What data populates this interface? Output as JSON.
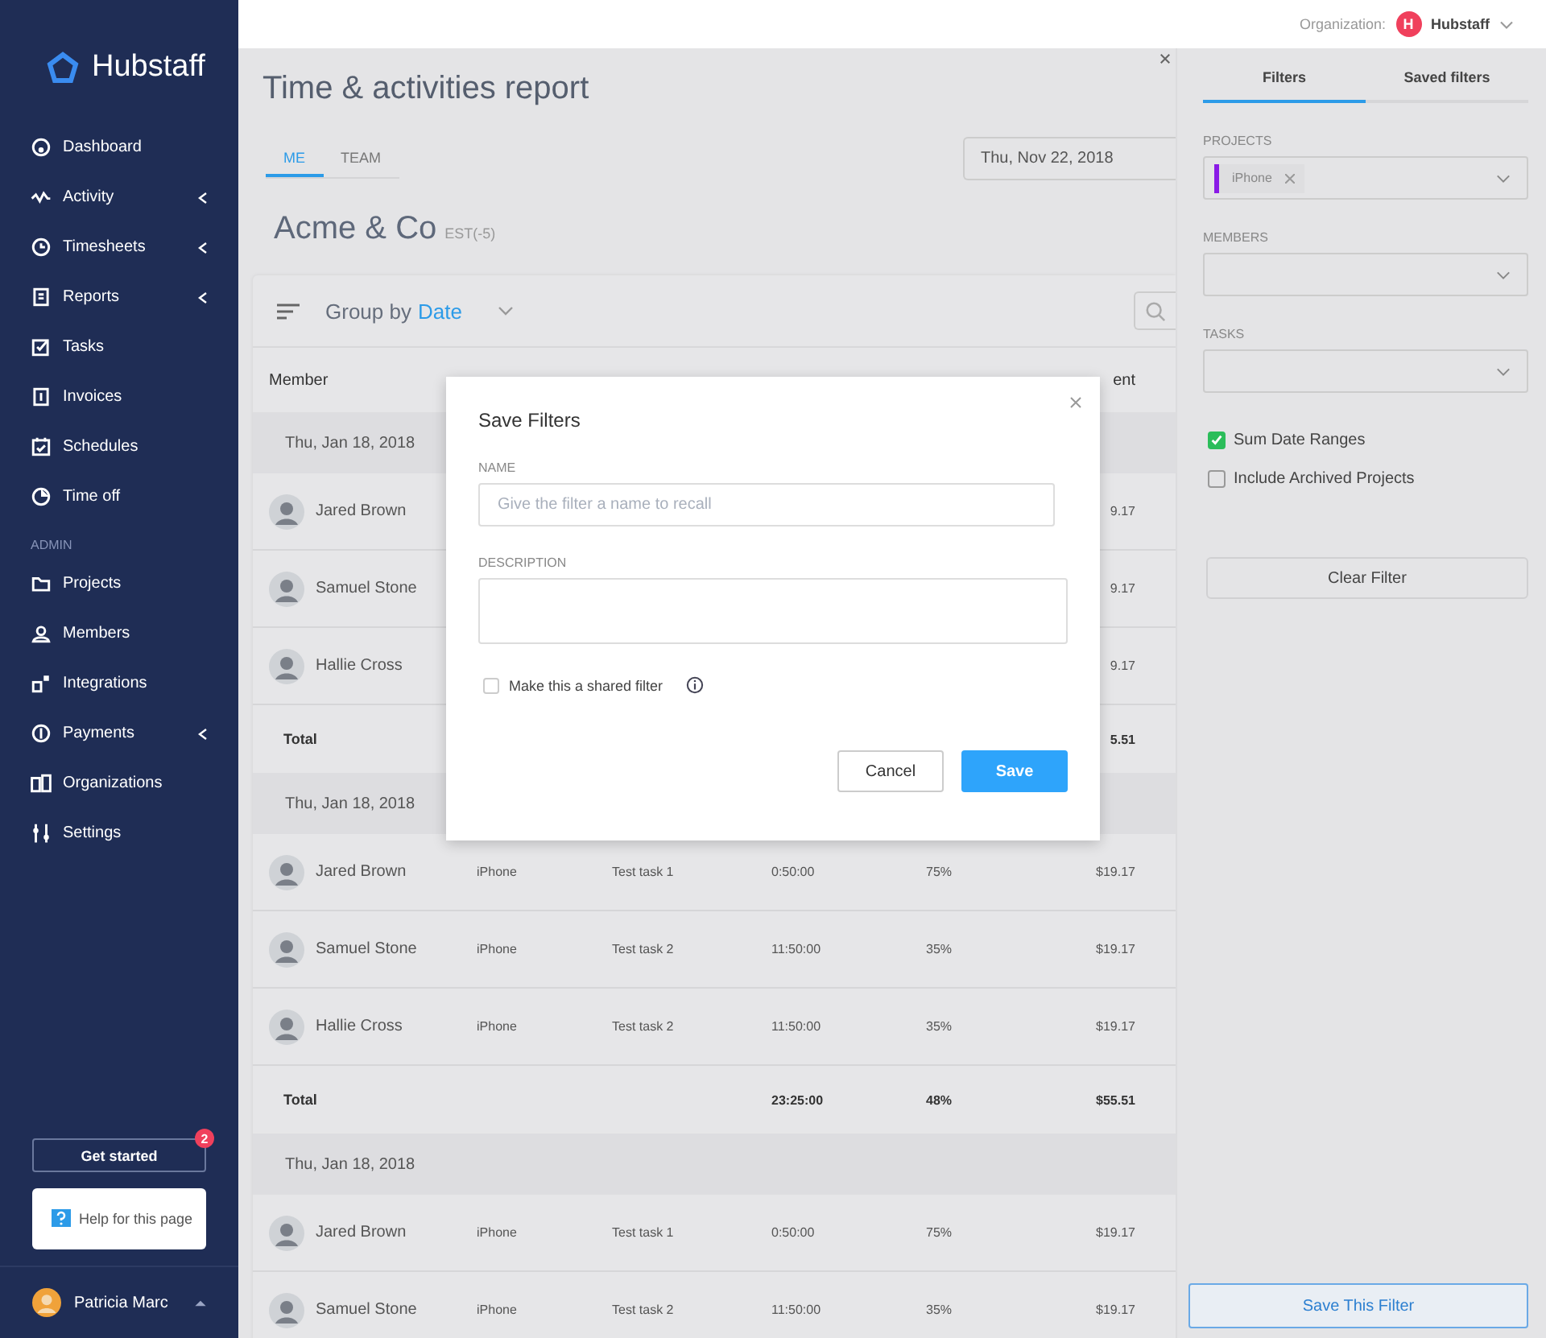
{
  "sidebar": {
    "brand": "Hubstaff",
    "sections": [
      {
        "items": [
          {
            "label": "Dashboard",
            "expandable": false
          },
          {
            "label": "Activity",
            "expandable": true
          },
          {
            "label": "Timesheets",
            "expandable": true
          },
          {
            "label": "Reports",
            "expandable": true
          },
          {
            "label": "Tasks",
            "expandable": false
          },
          {
            "label": "Invoices",
            "expandable": false
          },
          {
            "label": "Schedules",
            "expandable": false
          },
          {
            "label": "Time off",
            "expandable": false
          }
        ]
      },
      {
        "heading": "ADMIN",
        "items": [
          {
            "label": "Projects",
            "expandable": false
          },
          {
            "label": "Members",
            "expandable": false
          },
          {
            "label": "Integrations",
            "expandable": false
          },
          {
            "label": "Payments",
            "expandable": true
          },
          {
            "label": "Organizations",
            "expandable": false
          },
          {
            "label": "Settings",
            "expandable": false
          }
        ]
      }
    ],
    "get_started": {
      "label": "Get started",
      "badge": "2"
    },
    "help": "Help for this page",
    "user": "Patricia Marc"
  },
  "topbar": {
    "org_label": "Organization:",
    "org_initial": "H",
    "org_name": "Hubstaff"
  },
  "report": {
    "title": "Time & activities report",
    "tabs": [
      {
        "label": "ME",
        "selected": true
      },
      {
        "label": "TEAM",
        "selected": false
      }
    ],
    "date": "Thu, Nov 22, 2018",
    "org": "Acme & Co",
    "timezone": "EST(-5)",
    "group_by_label": "Group by",
    "group_by_value": "Date",
    "columns": {
      "member": "Member",
      "spent": "ent"
    },
    "groups": [
      {
        "date": "Thu, Jan 18, 2018",
        "rows": [
          {
            "member": "Jared Brown",
            "spent": "9.17"
          },
          {
            "member": "Samuel Stone",
            "spent": "9.17"
          },
          {
            "member": "Hallie Cross",
            "spent": "9.17"
          }
        ],
        "total": {
          "label": "Total",
          "spent": "5.51"
        }
      },
      {
        "date": "Thu, Jan 18, 2018",
        "rows": [
          {
            "member": "Jared Brown",
            "project": "iPhone",
            "task": "Test task 1",
            "time": "0:50:00",
            "activity": "75%",
            "spent": "$19.17"
          },
          {
            "member": "Samuel Stone",
            "project": "iPhone",
            "task": "Test task 2",
            "time": "11:50:00",
            "activity": "35%",
            "spent": "$19.17"
          },
          {
            "member": "Hallie Cross",
            "project": "iPhone",
            "task": "Test task 2",
            "time": "11:50:00",
            "activity": "35%",
            "spent": "$19.17"
          }
        ],
        "total": {
          "label": "Total",
          "time": "23:25:00",
          "activity": "48%",
          "spent": "$55.51"
        }
      },
      {
        "date": "Thu, Jan 18, 2018",
        "rows": [
          {
            "member": "Jared Brown",
            "project": "iPhone",
            "task": "Test task 1",
            "time": "0:50:00",
            "activity": "75%",
            "spent": "$19.17"
          },
          {
            "member": "Samuel Stone",
            "project": "iPhone",
            "task": "Test task 2",
            "time": "11:50:00",
            "activity": "35%",
            "spent": "$19.17"
          }
        ]
      }
    ]
  },
  "filters": {
    "tabs": [
      {
        "label": "Filters",
        "selected": true
      },
      {
        "label": "Saved filters",
        "selected": false
      }
    ],
    "fields": [
      {
        "label": "PROJECTS",
        "chips": [
          {
            "label": "iPhone",
            "color": "#8a1be6"
          }
        ]
      },
      {
        "label": "MEMBERS"
      },
      {
        "label": "TASKS"
      }
    ],
    "options": [
      {
        "label": "Sum Date Ranges",
        "checked": true
      },
      {
        "label": "Include Archived Projects",
        "checked": false
      }
    ],
    "clear_button": "Clear Filter",
    "save_button": "Save This Filter"
  },
  "dialog": {
    "title": "Save Filters",
    "name_label": "NAME",
    "name_placeholder": "Give the filter a name to recall",
    "description_label": "DESCRIPTION",
    "shared": {
      "label": "Make this a shared filter",
      "checked": false
    },
    "cancel": "Cancel",
    "save": "Save"
  }
}
